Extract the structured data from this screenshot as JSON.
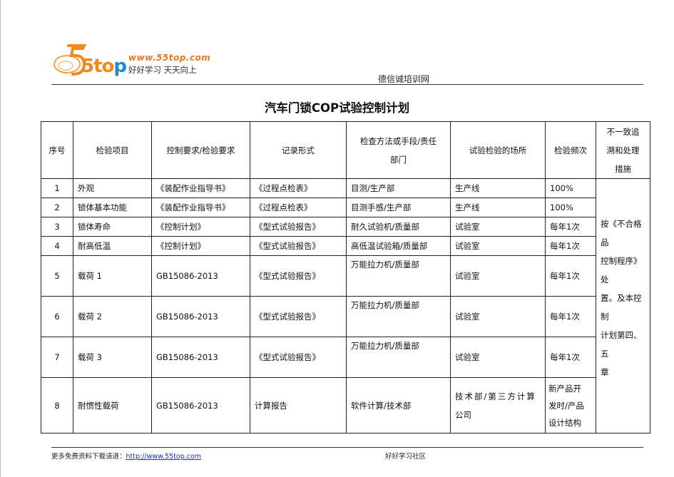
{
  "logo": {
    "url": "www.55top.com",
    "brand_5": "5",
    "brand_to": "to",
    "brand_p": "p",
    "slogan": "好好学习  天天向上"
  },
  "header": {
    "site_name": "德信诚培训网"
  },
  "document": {
    "title": "汽车门锁COP试验控制计划"
  },
  "table": {
    "headers": {
      "no": "序号",
      "item": "检验项目",
      "requirement": "控制要求/检验要求",
      "record": "记录形式",
      "method_a": "检查方法或手段/责任",
      "method_b": "部门",
      "place": "试验检验的场所",
      "freq": "检验频次",
      "measure_a": "不一致追",
      "measure_b": "溯和处理",
      "measure_c": "措施"
    },
    "rows": [
      {
        "no": "1",
        "item": "外观",
        "requirement": "《装配作业指导书》",
        "record": "《过程点检表》",
        "method": "目测/生产部",
        "place": "生产线",
        "freq": "100%"
      },
      {
        "no": "2",
        "item": "锁体基本功能",
        "requirement": "《装配作业指导书》",
        "record": "《过程点检表》",
        "method": "目测手感/生产部",
        "place": "生产线",
        "freq": "100%"
      },
      {
        "no": "3",
        "item": "锁体寿命",
        "requirement": "《控制计划》",
        "record": "《型式试验报告》",
        "method": "耐久试验机/质量部",
        "place": "试验室",
        "freq": "每年1次"
      },
      {
        "no": "4",
        "item": "耐高低温",
        "requirement": "《控制计划》",
        "record": "《型式试验报告》",
        "method": "高低温试验箱/质量部",
        "place": "试验室",
        "freq": "每年1次"
      },
      {
        "no": "5",
        "item": "载荷 1",
        "requirement": "GB15086-2013",
        "record": "《型式试验报告》",
        "method": "万能拉力机/质量部",
        "place": "试验室",
        "freq": "每年1次"
      },
      {
        "no": "6",
        "item": "载荷 2",
        "requirement": "GB15086-2013",
        "record": "《型式试验报告》",
        "method": "万能拉力机/质量部",
        "place": "试验室",
        "freq": "每年1次"
      },
      {
        "no": "7",
        "item": "载荷 3",
        "requirement": "GB15086-2013",
        "record": "《型式试验报告》",
        "method": "万能拉力机/质量部",
        "place": "试验室",
        "freq": "每年1次"
      },
      {
        "no": "8",
        "item": "耐惯性载荷",
        "requirement": "GB15086-2013",
        "record": "计算报告",
        "method": "软件计算/技术部",
        "place_a": "技术部/第三方计算",
        "place_b": "公司",
        "freq_a": "新产品开",
        "freq_b": "发时/产品",
        "freq_c": "设计结构"
      }
    ],
    "measure_lines": [
      "按《不合格",
      "品",
      "控制程序》",
      "处",
      "置。及本控",
      "制",
      "计划第四、",
      "五",
      "章"
    ]
  },
  "footer": {
    "more_prefix": "更多免费资料下载请进：",
    "link": "http://www.55top.com",
    "community": "好好学习社区"
  },
  "colors": {
    "logo_orange": "#f08a1e",
    "logo_blue": "#1e8ad6",
    "link_blue": "#1a2fbf"
  }
}
